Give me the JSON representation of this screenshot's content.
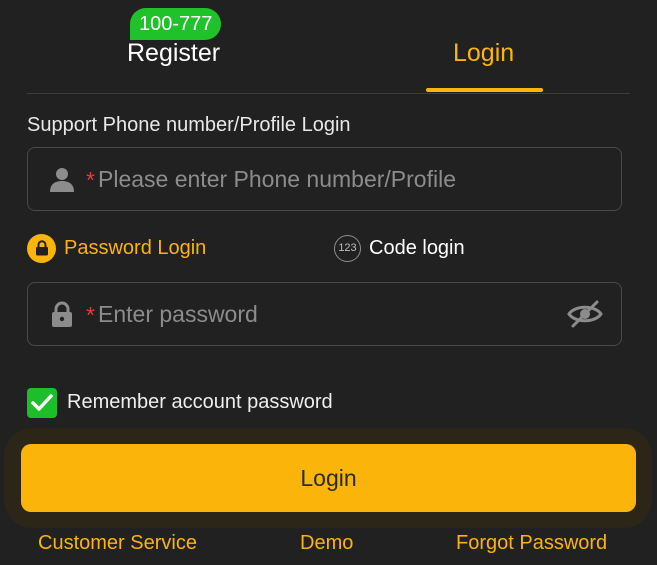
{
  "tabs": {
    "register": "Register",
    "login": "Login",
    "active": "login"
  },
  "badge": {
    "text": "100-777"
  },
  "form": {
    "section_label": "Support Phone number/Profile Login",
    "phone": {
      "required_mark": "*",
      "placeholder": "Please enter Phone number/Profile",
      "icon": "user-icon",
      "value": ""
    },
    "modes": {
      "password": {
        "label": "Password Login",
        "icon": "lock-icon",
        "active": true
      },
      "code": {
        "label": "Code login",
        "icon_text": "123",
        "active": false
      }
    },
    "password": {
      "required_mark": "*",
      "placeholder": "Enter password",
      "icon": "lock-icon",
      "toggle_icon": "eye-off-icon",
      "value": ""
    },
    "remember": {
      "label": "Remember account password",
      "checked": true
    },
    "submit": "Login"
  },
  "footer": {
    "customer_service": "Customer Service",
    "demo": "Demo",
    "forgot_password": "Forgot Password"
  },
  "colors": {
    "background": "#212121",
    "accent": "#fbb40a",
    "badge": "#1fc22a",
    "required": "#e23b3b",
    "checkbox": "#1ebd2a"
  }
}
